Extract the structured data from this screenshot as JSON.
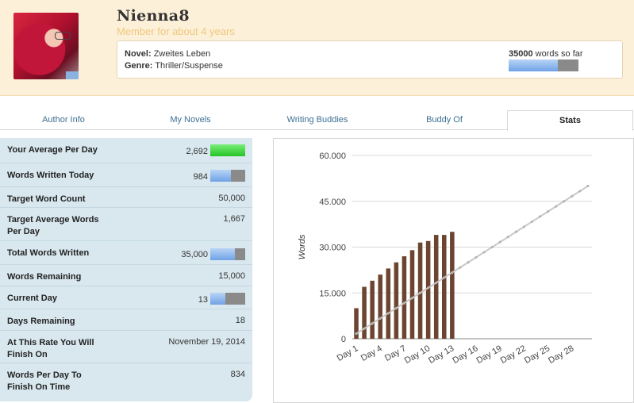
{
  "profile": {
    "username": "Nienna8",
    "member_since": "Member for about 4 years",
    "avatar_icon": "profile-photo"
  },
  "novel": {
    "novel_label": "Novel:",
    "novel_title": "Zweites Leben",
    "genre_label": "Genre:",
    "genre": "Thriller/Suspense",
    "words_count": "35000",
    "words_suffix": "words so far",
    "progress_fraction": 0.7
  },
  "tabs": [
    {
      "label": "Author Info",
      "active": false
    },
    {
      "label": "My Novels",
      "active": false
    },
    {
      "label": "Writing Buddies",
      "active": false
    },
    {
      "label": "Buddy Of",
      "active": false
    },
    {
      "label": "Stats",
      "active": true
    }
  ],
  "stats": [
    {
      "label": "Your Average Per Day",
      "value": "2,692",
      "bar": "green",
      "fraction": 1.0
    },
    {
      "label": "Words Written Today",
      "value": "984",
      "bar": "blue",
      "fraction": 0.59
    },
    {
      "label": "Target Word Count",
      "value": "50,000"
    },
    {
      "label": "Target Average Words Per Day",
      "value": "1,667"
    },
    {
      "label": "Total Words Written",
      "value": "35,000",
      "bar": "blue",
      "fraction": 0.7
    },
    {
      "label": "Words Remaining",
      "value": "15,000"
    },
    {
      "label": "Current Day",
      "value": "13",
      "bar": "blue",
      "fraction": 0.43
    },
    {
      "label": "Days Remaining",
      "value": "18"
    },
    {
      "label": "At This Rate You Will Finish On",
      "value": "November 19, 2014"
    },
    {
      "label": "Words Per Day To Finish On Time",
      "value": "834"
    }
  ],
  "colors": {
    "header_bg": "#fdf0d9",
    "member_text": "#f0c77e",
    "stats_bg": "#d9e8ef",
    "bar_blue": "#6fa2e6",
    "bar_green": "#25c325",
    "bar_gray": "#8a8a8a",
    "chart_bar": "#6b4530",
    "target_line": "#c8c8c8",
    "tab_text": "#3d6f94"
  },
  "chart_data": {
    "type": "bar",
    "ylabel": "Words",
    "ylim": [
      0,
      60000
    ],
    "yticks": [
      "0",
      "15.000",
      "30.000",
      "45.000",
      "60.000"
    ],
    "x_tick_labels": [
      "Day 1",
      "Day 4",
      "Day 7",
      "Day 10",
      "Day 13",
      "Day 16",
      "Day 19",
      "Day 22",
      "Day 25",
      "Day 28"
    ],
    "series": [
      {
        "values": [
          10000,
          17000,
          19000,
          21000,
          23000,
          25000,
          27000,
          29000,
          31500,
          32000,
          34000,
          34000,
          35000
        ]
      },
      {
        "type": "line",
        "start": [
          1,
          1667
        ],
        "end": [
          30,
          50000
        ]
      }
    ],
    "grid": true
  }
}
